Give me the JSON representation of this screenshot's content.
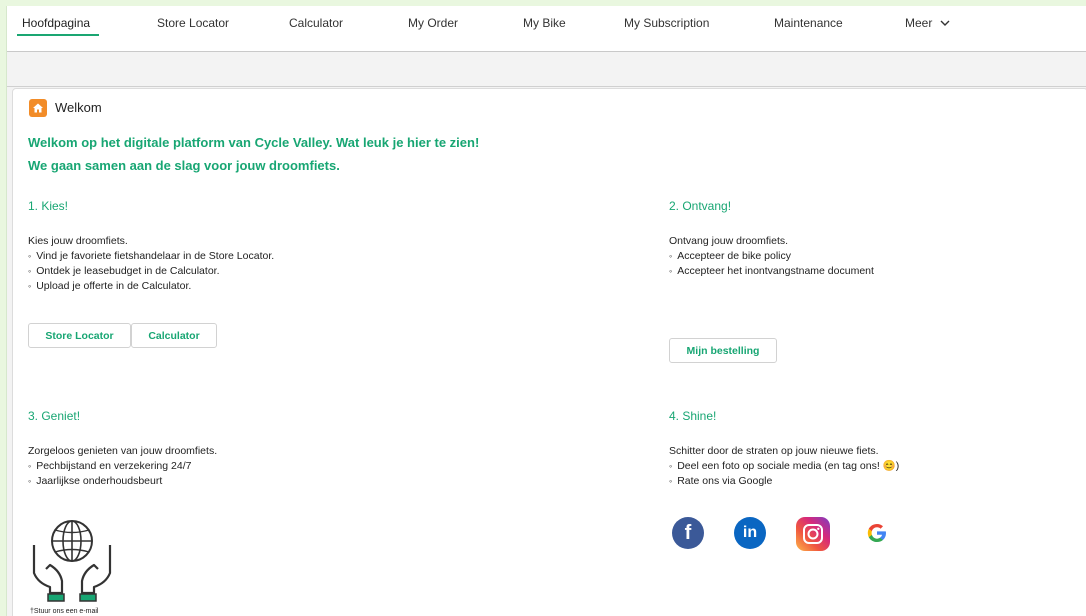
{
  "nav": {
    "items": [
      {
        "label": "Hoofdpagina"
      },
      {
        "label": "Store Locator"
      },
      {
        "label": "Calculator"
      },
      {
        "label": "My Order"
      },
      {
        "label": "My Bike"
      },
      {
        "label": "My Subscription"
      },
      {
        "label": "Maintenance"
      },
      {
        "label": "Meer"
      }
    ],
    "active": "Hoofdpagina"
  },
  "card": {
    "title": "Welkom",
    "welcome_line1": "Welkom op het digitale platform van Cycle Valley. Wat leuk je hier te zien!",
    "welcome_line2": "We gaan samen aan de slag voor jouw droomfiets."
  },
  "sections": {
    "kies": {
      "heading": "1. Kies!",
      "intro": "Kies jouw droomfiets.",
      "bullets": [
        "Vind je favoriete fietshandelaar in de Store Locator.",
        "Ontdek je leasebudget in de Calculator.",
        "Upload je offerte in de Calculator."
      ],
      "buttons": [
        "Store Locator",
        "Calculator"
      ]
    },
    "ontvang": {
      "heading": "2. Ontvang!",
      "intro": "Ontvang jouw droomfiets.",
      "bullets": [
        "Accepteer de bike policy",
        "Accepteer het inontvangstname document"
      ],
      "button": "Mijn bestelling"
    },
    "geniet": {
      "heading": "3. Geniet!",
      "intro": "Zorgeloos genieten van jouw droomfiets.",
      "bullets": [
        "Pechbijstand en verzekering 24/7",
        "Jaarlijkse onderhoudsbeurt"
      ],
      "footnote": "†Stuur ons een e-mail"
    },
    "shine": {
      "heading": "4. Shine!",
      "intro": "Schitter door de straten op jouw nieuwe fiets.",
      "bullets": [
        "Deel een foto op sociale media (en tag ons! 😊)",
        "Rate ons via Google"
      ],
      "social": [
        {
          "icon": "facebook-icon",
          "glyph": "f",
          "color": "#3b5998"
        },
        {
          "icon": "linkedin-icon",
          "glyph": "in",
          "color": "#0a66c2"
        },
        {
          "icon": "instagram-icon",
          "glyph": "",
          "color": "#d6297b"
        },
        {
          "icon": "google-icon",
          "glyph": "G",
          "color": "#4285f4"
        }
      ]
    }
  },
  "colors": {
    "accent": "#18a673",
    "home_badge": "#f28c28",
    "background": "#e9f7df"
  }
}
